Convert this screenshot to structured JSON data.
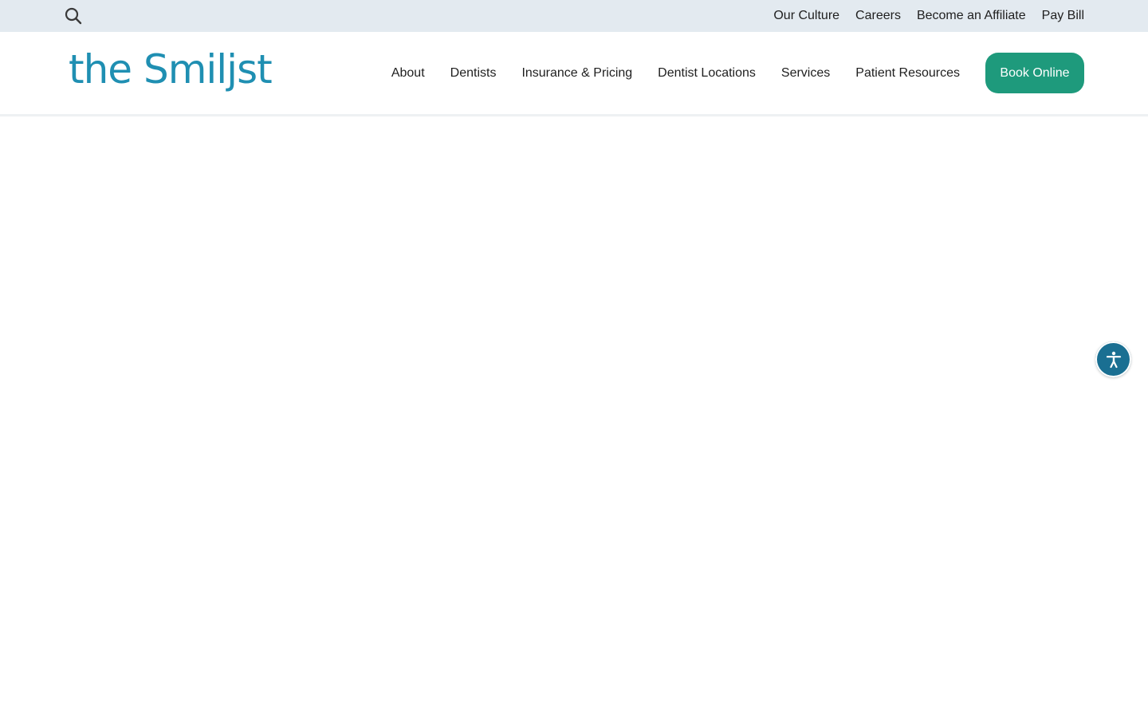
{
  "utility_bar": {
    "search_icon": "search-icon",
    "links": [
      {
        "label": "Our Culture"
      },
      {
        "label": "Careers"
      },
      {
        "label": "Become an Affiliate"
      },
      {
        "label": "Pay Bill"
      }
    ]
  },
  "header": {
    "logo_text": "the Smiljst",
    "nav": [
      {
        "label": "About"
      },
      {
        "label": "Dentists"
      },
      {
        "label": "Insurance & Pricing"
      },
      {
        "label": "Dentist Locations"
      },
      {
        "label": "Services"
      },
      {
        "label": "Patient Resources"
      }
    ],
    "book_button_label": "Book Online"
  },
  "accessibility": {
    "icon": "accessibility-icon"
  },
  "colors": {
    "utility_bar_bg": "#e3eaf0",
    "brand_blue": "#1f8fb2",
    "book_button_bg": "#1e9a7c",
    "accessibility_bg": "#1a6f92"
  }
}
